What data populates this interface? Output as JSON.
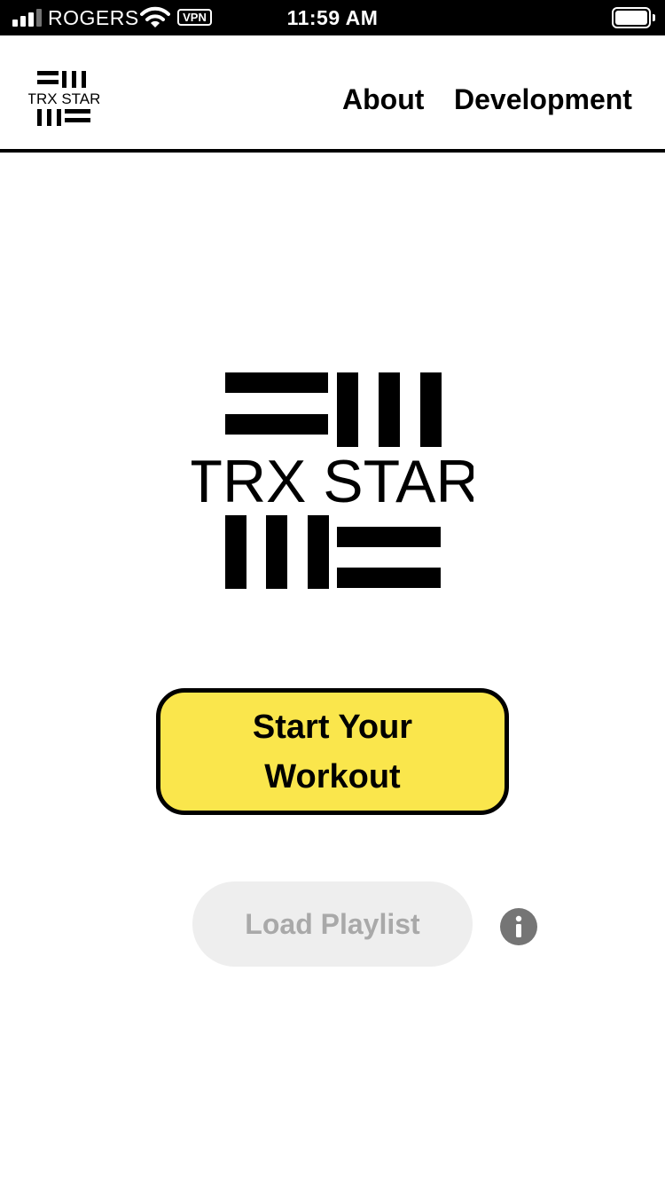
{
  "status_bar": {
    "carrier": "ROGERS",
    "vpn_label": "VPN",
    "time": "11:59 AM",
    "icons": [
      "signal-icon",
      "wifi-icon",
      "vpn-icon",
      "battery-icon"
    ]
  },
  "header": {
    "logo_text": "TRX STAR",
    "nav": {
      "about_label": "About",
      "development_label": "Development"
    }
  },
  "main": {
    "hero_logo_text": "TRX STAR",
    "start_button_label": "Start Your Workout",
    "load_playlist_label": "Load Playlist",
    "info_icon": "info-icon"
  },
  "colors": {
    "status_bar_bg": "#000000",
    "start_button_bg": "#fae64c",
    "playlist_button_bg": "#eeeeee",
    "playlist_button_text": "#a9a9a9",
    "info_icon_bg": "#757575"
  }
}
